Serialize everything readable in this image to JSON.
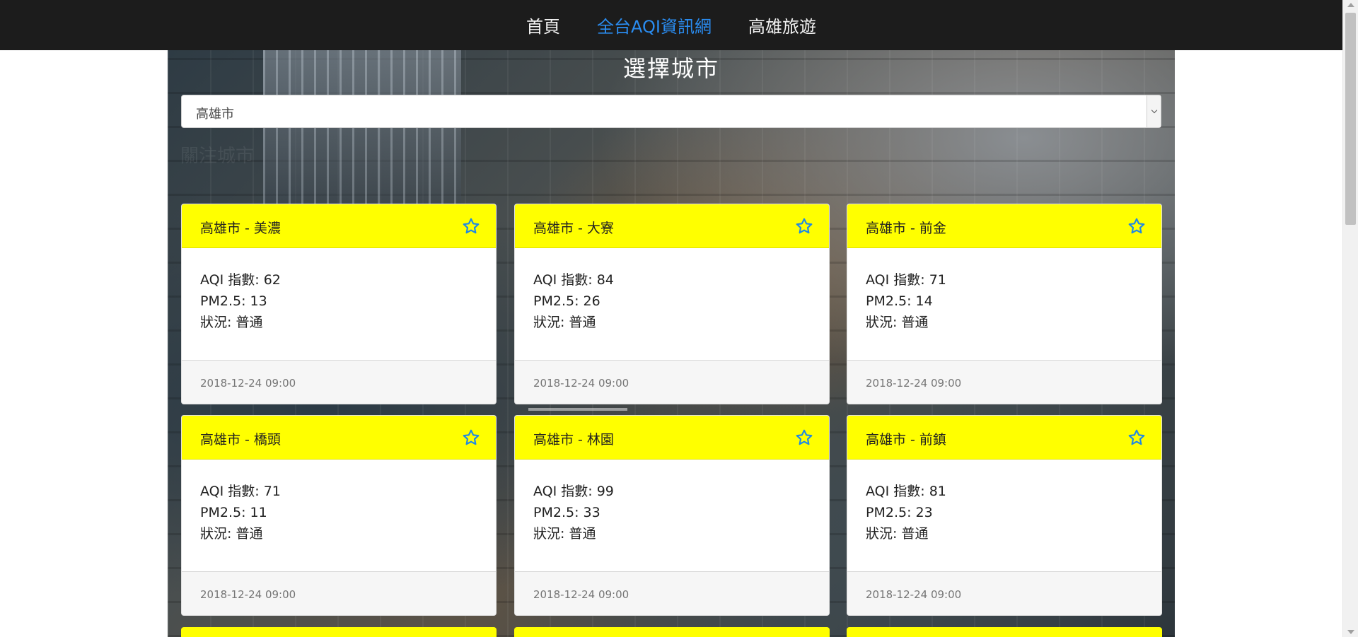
{
  "nav": {
    "items": [
      {
        "label": "首頁"
      },
      {
        "label": "全台AQI資訊網",
        "active": true
      },
      {
        "label": "高雄旅遊"
      }
    ]
  },
  "page": {
    "title": "選擇城市",
    "ghost_text": "關注城市"
  },
  "city_select": {
    "value": "高雄市"
  },
  "cards": [
    {
      "title": "高雄市 - 美濃",
      "aqi": "AQI 指數: 62",
      "pm25": "PM2.5: 13",
      "status": "狀況: 普通",
      "time": "2018-12-24 09:00"
    },
    {
      "title": "高雄市 - 大寮",
      "aqi": "AQI 指數: 84",
      "pm25": "PM2.5: 26",
      "status": "狀況: 普通",
      "time": "2018-12-24 09:00"
    },
    {
      "title": "高雄市 - 前金",
      "aqi": "AQI 指數: 71",
      "pm25": "PM2.5: 14",
      "status": "狀況: 普通",
      "time": "2018-12-24 09:00"
    },
    {
      "title": "高雄市 - 橋頭",
      "aqi": "AQI 指數: 71",
      "pm25": "PM2.5: 11",
      "status": "狀況: 普通",
      "time": "2018-12-24 09:00"
    },
    {
      "title": "高雄市 - 林園",
      "aqi": "AQI 指數: 99",
      "pm25": "PM2.5: 33",
      "status": "狀況: 普通",
      "time": "2018-12-24 09:00"
    },
    {
      "title": "高雄市 - 前鎮",
      "aqi": "AQI 指數: 81",
      "pm25": "PM2.5: 23",
      "status": "狀況: 普通",
      "time": "2018-12-24 09:00"
    }
  ],
  "colors": {
    "navbar": "#1c1c1c",
    "nav_active": "#2a8cf0",
    "card_header": "#ffff00",
    "star": "#1e88e5"
  },
  "icons": {
    "favorite": "star-outline-icon"
  }
}
